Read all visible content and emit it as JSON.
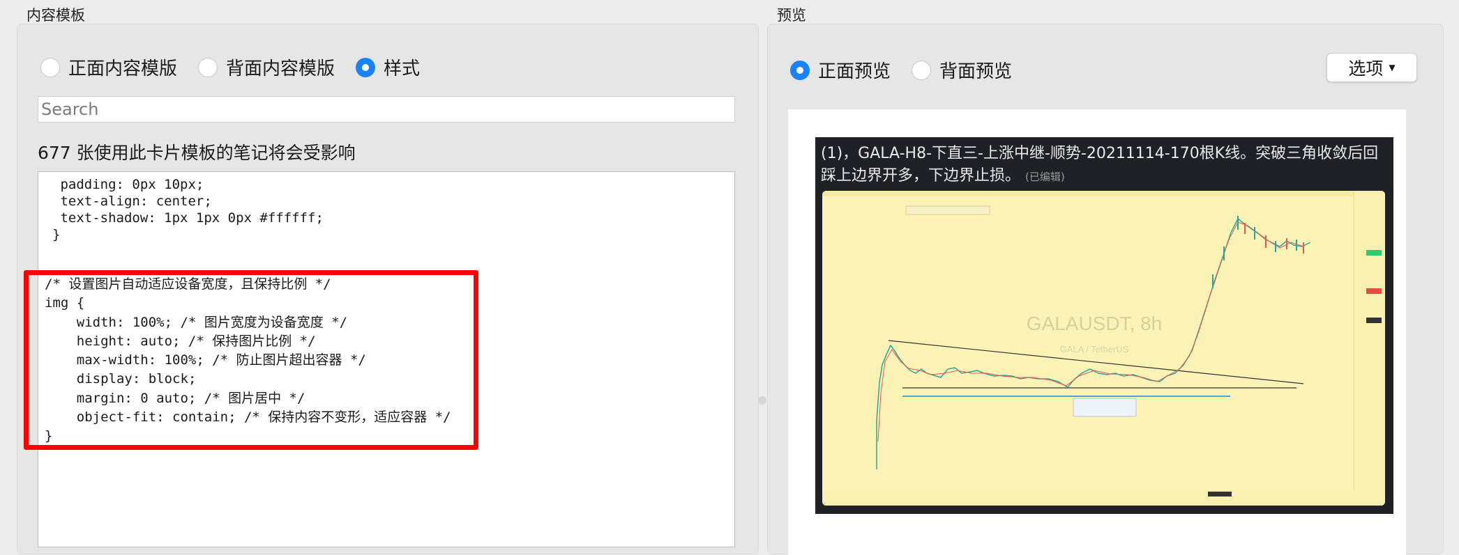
{
  "left_panel": {
    "title": "内容模板",
    "radios": [
      {
        "label": "正面内容模版",
        "checked": false
      },
      {
        "label": "背面内容模版",
        "checked": false
      },
      {
        "label": "样式",
        "checked": true
      }
    ],
    "search_placeholder": "Search",
    "affected_text": "677 张使用此卡片模板的笔记将会受影响",
    "code_top": " padding: 0px 10px;\n text-align: center;\n text-shadow: 1px 1px 0px #ffffff;\n}",
    "code_highlight": "/* 设置图片自动适应设备宽度，且保持比例 */\nimg {\n    width: 100%; /* 图片宽度为设备宽度 */\n    height: auto; /* 保持图片比例 */\n    max-width: 100%; /* 防止图片超出容器 */\n    display: block;\n    margin: 0 auto; /* 图片居中 */\n    object-fit: contain; /* 保持内容不变形，适应容器 */\n}"
  },
  "right_panel": {
    "title": "预览",
    "radios": [
      {
        "label": "正面预览",
        "checked": true
      },
      {
        "label": "背面预览",
        "checked": false
      }
    ],
    "options_label": "选项",
    "note_title": "(1)，GALA-H8-下直三-上涨中继-顺势-20211114-170根K线。突破三角收敛后回踩上边界开多，下边界止损。",
    "note_edited": "(已编辑)",
    "chart_watermark": "GALAUSDT, 8h",
    "chart_sub_watermark": "GALA / TetherUS"
  },
  "colors": {
    "accent": "#1a82fb",
    "highlight_border": "#ff0000",
    "chart_bg": "#fbf3b5"
  }
}
